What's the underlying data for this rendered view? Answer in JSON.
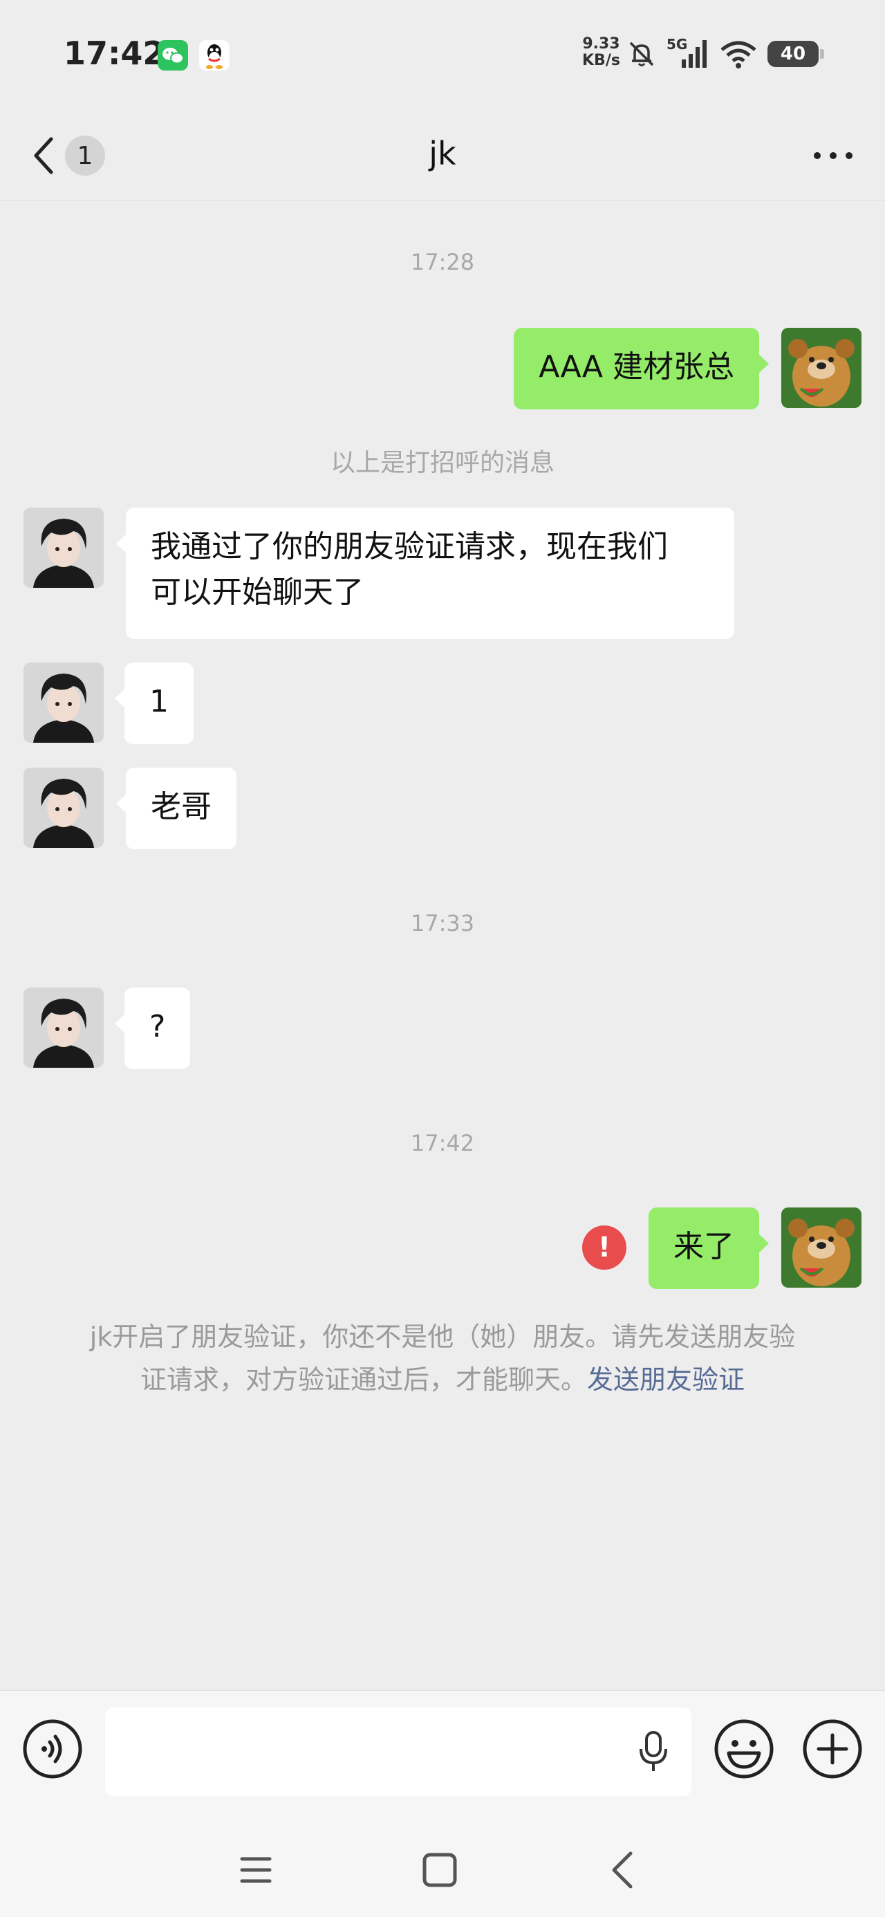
{
  "status_bar": {
    "time": "17:42",
    "net_speed_value": "9.33",
    "net_speed_unit": "KB/s",
    "signal": "5G",
    "battery": "40",
    "icons": [
      "wechat-icon",
      "qq-icon",
      "mute-bell-icon",
      "signal-icon",
      "wifi-icon",
      "battery-icon"
    ]
  },
  "header": {
    "back_badge": "1",
    "title": "jk",
    "more_icon": "more-dots-icon"
  },
  "messages": {
    "time_1": "17:28",
    "out_1": "AAA 建材张总",
    "system_1": "以上是打招呼的消息",
    "in_1_line1": "我通过了你的朋友验证请求，现在我们",
    "in_1_line2": "可以开始聊天了",
    "in_2": "1",
    "in_3": "老哥",
    "time_2": "17:33",
    "in_4": "?",
    "time_3": "17:42",
    "out_2": "来了",
    "error_mark": "!"
  },
  "notice": {
    "line1": "jk开启了朋友验证，你还不是他（她）朋友。请先发送朋友验",
    "line2_text": "证请求，对方验证通过后，才能聊天。",
    "link": "发送朋友验证"
  },
  "toolbar": {
    "icons": [
      "voice-icon",
      "mic-icon",
      "emoji-icon",
      "plus-icon"
    ]
  },
  "colors": {
    "background": "#ededed",
    "outgoing_bubble": "#95ec69",
    "incoming_bubble": "#ffffff",
    "link": "#576b95",
    "error": "#e84c4c"
  }
}
